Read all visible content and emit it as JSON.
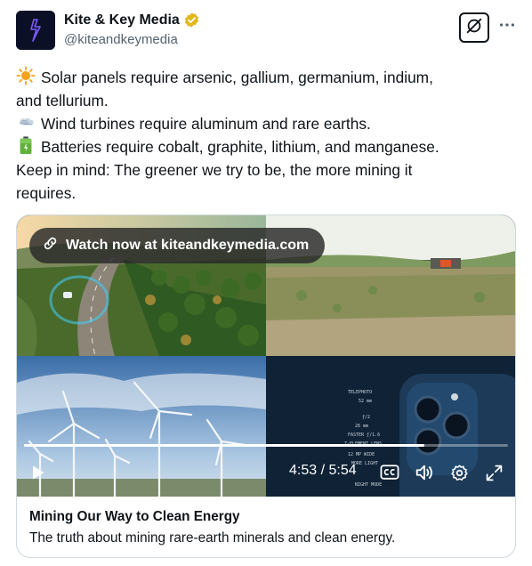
{
  "author": {
    "display_name": "Kite & Key Media",
    "handle": "@kiteandkeymedia",
    "verified_color": "#e2b719"
  },
  "tweet": {
    "lines": [
      {
        "icon": "sun-emoji",
        "text": "Solar panels require arsenic, gallium, germanium, indium,"
      },
      {
        "icon": "",
        "text": "and tellurium."
      },
      {
        "icon": "wind-emoji",
        "text": "Wind turbines require aluminum and rare earths."
      },
      {
        "icon": "battery-emoji",
        "text": "Batteries require cobalt, graphite, lithium, and manganese."
      },
      {
        "icon": "",
        "text": "Keep in mind: The greener we try to be, the more mining it"
      },
      {
        "icon": "",
        "text": "requires."
      }
    ]
  },
  "video": {
    "watch_label": "Watch now at kiteandkeymedia.com",
    "current_time": "4:53",
    "duration": "5:54",
    "time_display": "4:53 / 5:54",
    "progress_fraction": 0.828
  },
  "card": {
    "title": "Mining Our Way to Clean Energy",
    "description": "The truth about mining rare-earth minerals and clean energy."
  },
  "colors": {
    "text_primary": "#0f1419",
    "text_secondary": "#536471",
    "border": "#cfd9de"
  }
}
